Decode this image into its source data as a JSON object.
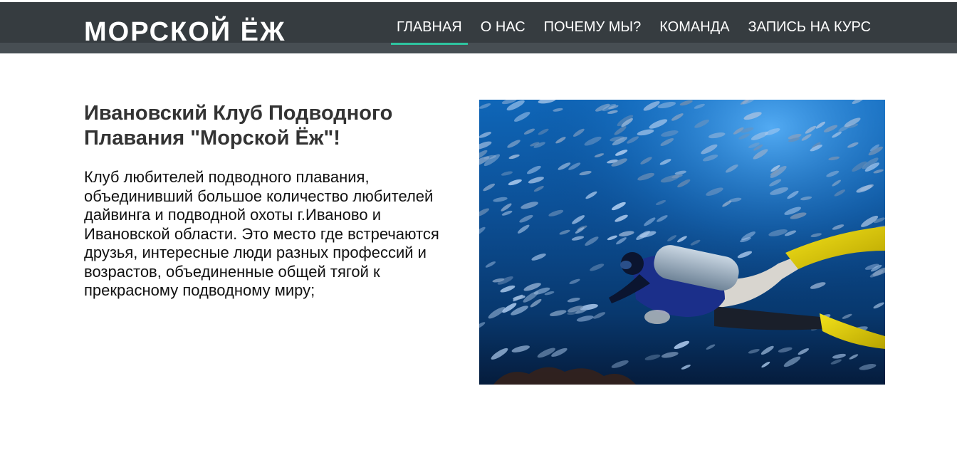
{
  "header": {
    "logo": "МОРСКОЙ ЁЖ",
    "nav": [
      {
        "label": "ГЛАВНАЯ",
        "active": true
      },
      {
        "label": "О НАС",
        "active": false
      },
      {
        "label": "ПОЧЕМУ МЫ?",
        "active": false
      },
      {
        "label": "КОМАНДА",
        "active": false
      },
      {
        "label": "ЗАПИСЬ НА КУРС",
        "active": false
      }
    ]
  },
  "main": {
    "title": "Ивановский Клуб Подводного Плавания \"Морской Ёж\"!",
    "description": "Клуб любителей подводного плавания, объединивший большое количество любителей дайвинга и подводной охоты г.Иваново и Ивановской области. Это место где встречаются друзья, интересные люди разных профессий и возрастов, объединенные общей тягой к прекрасному подводному миру;",
    "image": {
      "subject": "scuba-diver-with-fish-school",
      "colors": {
        "water_top": "#1a7fd0",
        "water_bottom": "#051c3c",
        "fins": "#e8d400",
        "tank": "#9fb4c8",
        "wetsuit": "#1b2f8a"
      }
    }
  },
  "theme": {
    "header_bg": "#363c40",
    "header_strip": "#474e53",
    "accent": "#2ec4a0",
    "text_dark": "#333333"
  }
}
